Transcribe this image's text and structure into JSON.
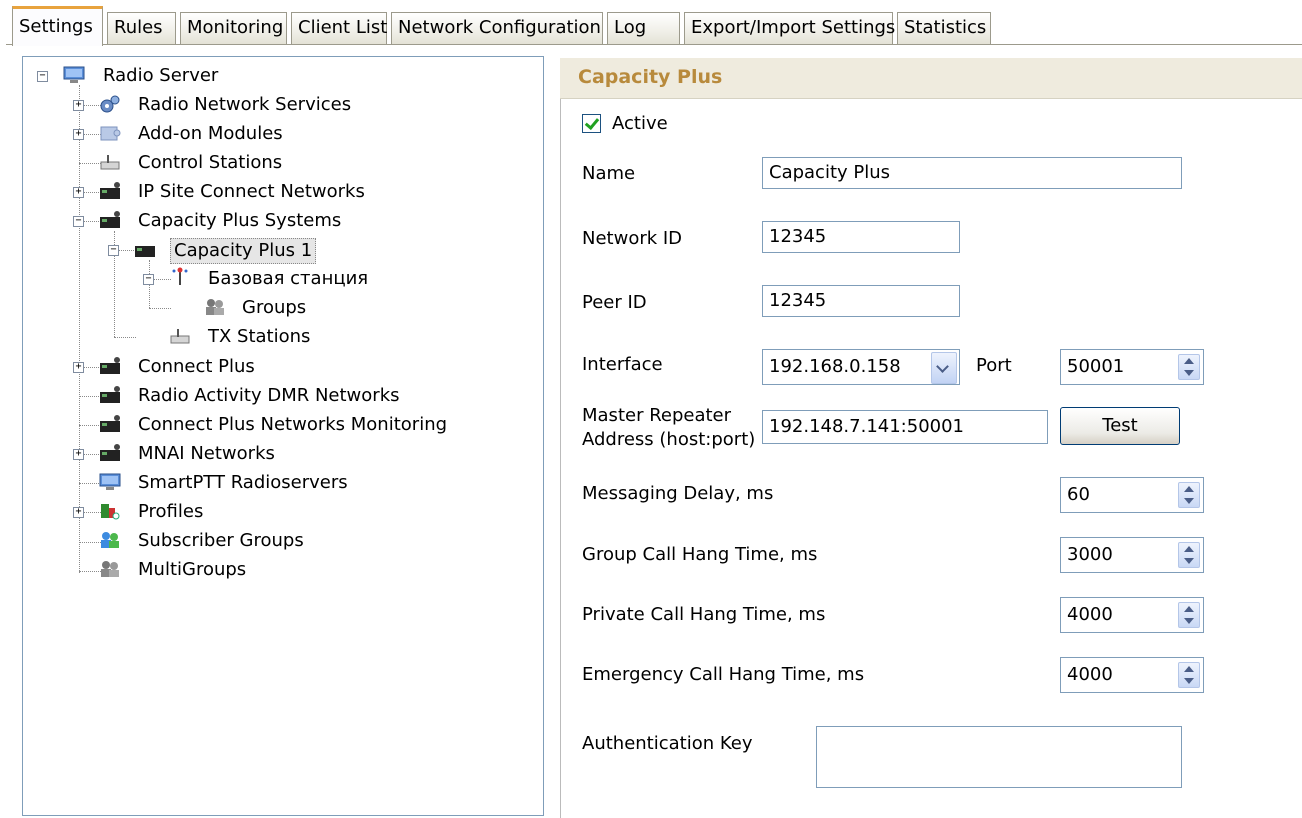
{
  "tabs": [
    "Settings",
    "Rules",
    "Monitoring",
    "Client List",
    "Network Configuration",
    "Log",
    "Export/Import Settings",
    "Statistics"
  ],
  "tree": {
    "root": "Radio Server",
    "radio_network_services": "Radio Network Services",
    "addon_modules": "Add-on Modules",
    "control_stations": "Control Stations",
    "ip_site_connect": "IP Site Connect Networks",
    "capacity_plus_systems": "Capacity Plus Systems",
    "capacity_plus_1": "Capacity Plus 1",
    "base_station": "Базовая станция",
    "groups": "Groups",
    "tx_stations": "TX Stations",
    "connect_plus": "Connect Plus",
    "radio_activity": "Radio Activity DMR Networks",
    "connect_plus_monitoring": "Connect Plus Networks Monitoring",
    "mnai": "MNAI Networks",
    "smartptt": "SmartPTT Radioservers",
    "profiles": "Profiles",
    "subscriber_groups": "Subscriber Groups",
    "multigroups": "MultiGroups"
  },
  "panel": {
    "title": "Capacity Plus",
    "active_label": "Active",
    "active_checked": true,
    "name_label": "Name",
    "name_value": "Capacity Plus",
    "network_id_label": "Network ID",
    "network_id_value": "12345",
    "peer_id_label": "Peer ID",
    "peer_id_value": "12345",
    "interface_label": "Interface",
    "interface_value": "192.168.0.158",
    "port_label": "Port",
    "port_value": "50001",
    "master_label_1": "Master Repeater",
    "master_label_2": "Address (host:port)",
    "master_value": "192.148.7.141:50001",
    "test_button": "Test",
    "messaging_delay_label": "Messaging Delay, ms",
    "messaging_delay_value": "60",
    "group_hang_label": "Group Call Hang Time, ms",
    "group_hang_value": "3000",
    "private_hang_label": "Private Call Hang Time, ms",
    "private_hang_value": "4000",
    "emergency_hang_label": "Emergency Call Hang Time, ms",
    "emergency_hang_value": "4000",
    "auth_key_label": "Authentication Key",
    "auth_key_value": ""
  },
  "colors": {
    "header_title": "#b88a3c",
    "active_tab_accent": "#e8a33d",
    "check_mark": "#21a121"
  }
}
